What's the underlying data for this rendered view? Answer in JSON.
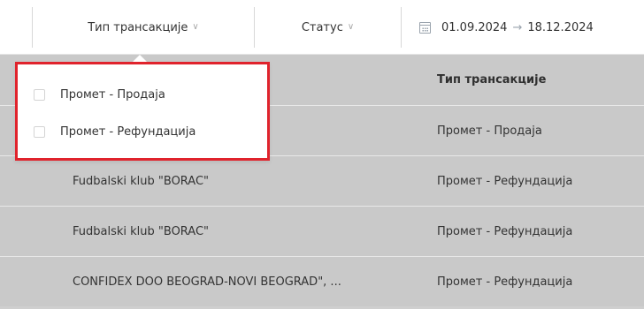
{
  "filters": {
    "transaction_type": {
      "label": "Тип трансакције",
      "icon": "chevron-down-icon"
    },
    "status": {
      "label": "Статус",
      "icon": "chevron-down-icon"
    },
    "date_range": {
      "start": "01.09.2024",
      "separator": "→",
      "end": "18.12.2024",
      "icon": "calendar-icon"
    }
  },
  "table": {
    "header": {
      "transaction_type": "Тип трансакције"
    },
    "rows": [
      {
        "partner": "",
        "transaction_type": "Промет - Продаја"
      },
      {
        "partner": "Fudbalski klub \"BORAC\"",
        "transaction_type": "Промет - Рефундација"
      },
      {
        "partner": "Fudbalski klub \"BORAC\"",
        "transaction_type": "Промет - Рефундација"
      },
      {
        "partner": "CONFIDEX DOO BEOGRAD-NOVI BEOGRAD\", ...",
        "transaction_type": "Промет - Рефундација"
      }
    ]
  },
  "dropdown": {
    "highlight_color": "#e0232c",
    "options": [
      {
        "label": "Промет - Продаја",
        "checked": false
      },
      {
        "label": "Промет - Рефундација",
        "checked": false
      }
    ]
  }
}
